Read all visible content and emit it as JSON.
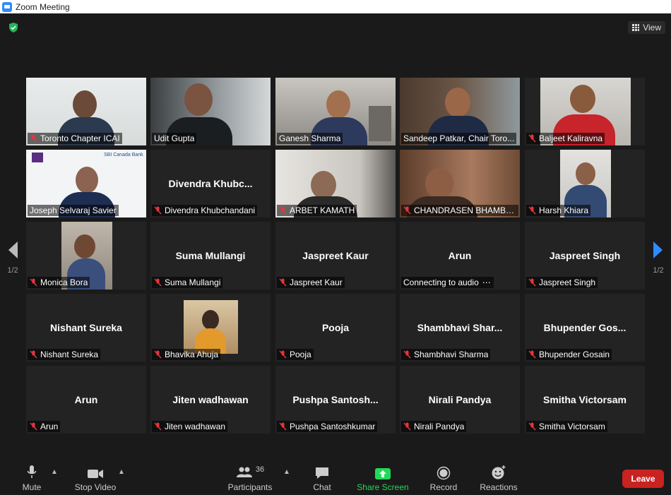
{
  "window": {
    "title": "Zoom Meeting"
  },
  "header": {
    "view_label": "View"
  },
  "pager": {
    "left": "1/2",
    "right": "1/2"
  },
  "tiles": [
    {
      "name": "Toronto Chapter ICAI",
      "big": "",
      "muted": true
    },
    {
      "name": "Udit Gupta",
      "big": "",
      "muted": false
    },
    {
      "name": "Ganesh Sharma",
      "big": "",
      "muted": false
    },
    {
      "name": "Sandeep Patkar, Chair Toro...",
      "big": "",
      "muted": false
    },
    {
      "name": "Baljeet Kaliravna",
      "big": "",
      "muted": true
    },
    {
      "name": "Joseph Selvaraj Savier",
      "big": "",
      "muted": false
    },
    {
      "name": "Divendra Khubchandani",
      "big": "Divendra  Khubc...",
      "muted": true
    },
    {
      "name": "ARBET KAMATH",
      "big": "",
      "muted": true
    },
    {
      "name": "CHANDRASEN BHAMBH...",
      "big": "",
      "muted": true
    },
    {
      "name": "Harsh Khiara",
      "big": "",
      "muted": true
    },
    {
      "name": "Monica Bora",
      "big": "",
      "muted": true
    },
    {
      "name": "Suma Mullangi",
      "big": "Suma Mullangi",
      "muted": true
    },
    {
      "name": "Jaspreet Kaur",
      "big": "Jaspreet Kaur",
      "muted": true
    },
    {
      "name": "Connecting to audio",
      "big": "Arun",
      "muted": false
    },
    {
      "name": "Jaspreet Singh",
      "big": "Jaspreet Singh",
      "muted": true
    },
    {
      "name": "Nishant Sureka",
      "big": "Nishant Sureka",
      "muted": true
    },
    {
      "name": "Bhavika Ahuja",
      "big": "",
      "muted": true
    },
    {
      "name": "Pooja",
      "big": "Pooja",
      "muted": true
    },
    {
      "name": "Shambhavi Sharma",
      "big": "Shambhavi  Shar...",
      "muted": true
    },
    {
      "name": "Bhupender Gosain",
      "big": "Bhupender  Gos...",
      "muted": true
    },
    {
      "name": "Arun",
      "big": "Arun",
      "muted": true
    },
    {
      "name": "Jiten wadhawan",
      "big": "Jiten wadhawan",
      "muted": true
    },
    {
      "name": "Pushpa Santoshkumar",
      "big": "Pushpa  Santosh...",
      "muted": true
    },
    {
      "name": "Nirali Pandya",
      "big": "Nirali Pandya",
      "muted": true
    },
    {
      "name": "Smitha Victorsam",
      "big": "Smitha Victorsam",
      "muted": true
    }
  ],
  "sdi_logo_text": "SBI Canada Bank",
  "toolbar": {
    "mute": "Mute",
    "stop_video": "Stop Video",
    "participants": "Participants",
    "participants_count": "36",
    "chat": "Chat",
    "share_screen": "Share Screen",
    "record": "Record",
    "reactions": "Reactions",
    "leave": "Leave"
  },
  "colors": {
    "active_speaker": "#c7e65a",
    "share_green": "#23d959",
    "leave_red": "#c82320",
    "nav_blue": "#2d8cff"
  },
  "icons": [
    "shield-icon",
    "grid-icon",
    "mic-muted-icon",
    "microphone-icon",
    "video-camera-icon",
    "participants-icon",
    "chat-icon",
    "share-screen-icon",
    "record-icon",
    "reactions-icon",
    "arrow-left-icon",
    "arrow-right-icon"
  ]
}
